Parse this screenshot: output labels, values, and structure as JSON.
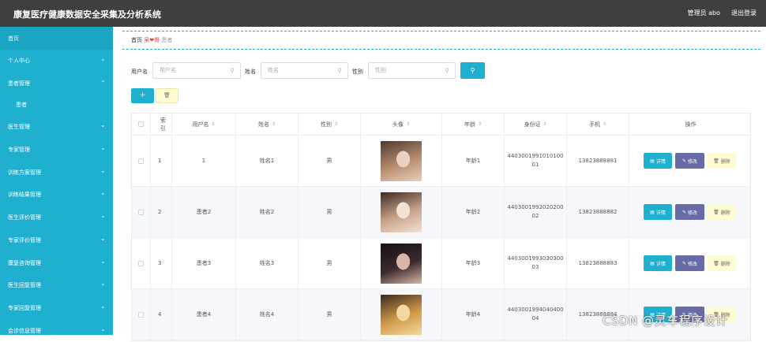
{
  "header": {
    "title": "康复医疗健康数据安全采集及分析系统",
    "user": "管理员 abo",
    "logout": "退出登录"
  },
  "sidebar": {
    "items": [
      {
        "label": "首页",
        "chevron": ""
      },
      {
        "label": "个人中心",
        "chevron": "chevron-down"
      },
      {
        "label": "患者管理",
        "chevron": "chevron-up"
      },
      {
        "label": "患者",
        "chevron": ""
      },
      {
        "label": "医生管理",
        "chevron": "chevron-down"
      },
      {
        "label": "专家管理",
        "chevron": "chevron-down"
      },
      {
        "label": "训练方案管理",
        "chevron": "chevron-down"
      },
      {
        "label": "训练结果管理",
        "chevron": "chevron-down"
      },
      {
        "label": "医生评价管理",
        "chevron": "chevron-down"
      },
      {
        "label": "专家评价管理",
        "chevron": "chevron-down"
      },
      {
        "label": "康复咨询管理",
        "chevron": "chevron-down"
      },
      {
        "label": "医生回复管理",
        "chevron": "chevron-down"
      },
      {
        "label": "专家回复管理",
        "chevron": "chevron-down"
      },
      {
        "label": "会诊信息管理",
        "chevron": "chevron-down"
      }
    ]
  },
  "breadcrumb": {
    "home": "首页",
    "mid": "吴",
    "heart": "❤",
    "mid2": "骨",
    "current": "患者"
  },
  "search": {
    "username_label": "用户名",
    "username_placeholder": "用户名",
    "name_label": "姓名",
    "name_placeholder": "姓名",
    "gender_label": "性别",
    "gender_placeholder": "性别"
  },
  "table": {
    "headers": [
      "索引",
      "用户名",
      "姓名",
      "性别",
      "头像",
      "年龄",
      "身份证",
      "手机",
      "操作"
    ],
    "rows": [
      {
        "index": "1",
        "username": "1",
        "name": "姓名1",
        "gender": "男",
        "age": "年龄1",
        "id_line1": "4403001991010100",
        "id_line2": "01",
        "phone": "13823888881",
        "photo_colors": [
          "#b88e6e",
          "#e7d1c0",
          "#4b3a2e"
        ]
      },
      {
        "index": "2",
        "username": "患者2",
        "name": "姓名2",
        "gender": "男",
        "age": "年龄2",
        "id_line1": "4403001992020200",
        "id_line2": "02",
        "phone": "13823888882",
        "photo_colors": [
          "#c9a48a",
          "#f1e2d6",
          "#3a2a22"
        ]
      },
      {
        "index": "3",
        "username": "患者3",
        "name": "姓名3",
        "gender": "男",
        "age": "年龄3",
        "id_line1": "4403001993030300",
        "id_line2": "03",
        "phone": "13823888883",
        "photo_colors": [
          "#3b2b2c",
          "#d9b6a8",
          "#151012"
        ]
      },
      {
        "index": "4",
        "username": "患者4",
        "name": "姓名4",
        "gender": "男",
        "age": "年龄4",
        "id_line1": "4403001994040400",
        "id_line2": "04",
        "phone": "13823888884",
        "photo_colors": [
          "#d19a4a",
          "#f3d9a0",
          "#3b2a1f"
        ]
      }
    ],
    "actions": {
      "detail": "详情",
      "edit": "修改",
      "delete": "删除"
    }
  },
  "watermark": "CSDN @灵车程序设计",
  "colors": {
    "accent": "#1fb0cf",
    "topbar": "#3f3f3f",
    "edit": "#686ba6",
    "delete": "#fffbd2"
  }
}
